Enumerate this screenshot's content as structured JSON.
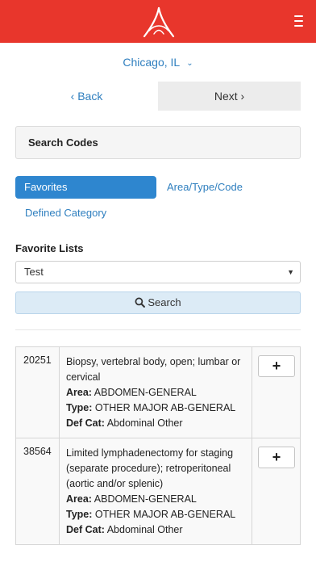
{
  "header": {
    "logo_icon": "caduceus-logo-icon",
    "menu_icon": "hamburger-menu-icon",
    "bar_color": "#e8362c"
  },
  "location": {
    "label": "Chicago, IL",
    "icon": "chevron-down-icon"
  },
  "nav": {
    "back_label": "‹ Back",
    "next_label": "Next ›"
  },
  "panel": {
    "title": "Search Codes"
  },
  "filters": {
    "active": "Favorites",
    "tabs": [
      "Favorites",
      "Area/Type/Code",
      "Defined Category"
    ]
  },
  "favorites": {
    "label": "Favorite Lists",
    "selected": "Test"
  },
  "search": {
    "label": "Search",
    "icon": "search-icon"
  },
  "results": [
    {
      "code": "20251",
      "description": "Biopsy, vertebral body, open; lumbar or cervical",
      "area_label": "Area:",
      "area": "ABDOMEN-GENERAL",
      "type_label": "Type:",
      "type": "OTHER MAJOR AB-GENERAL",
      "defcat_label": "Def Cat:",
      "defcat": "Abdominal Other",
      "add_label": "+"
    },
    {
      "code": "38564",
      "description": "Limited lymphadenectomy for staging (separate procedure); retroperitoneal (aortic and/or splenic)",
      "area_label": "Area:",
      "area": "ABDOMEN-GENERAL",
      "type_label": "Type:",
      "type": "OTHER MAJOR AB-GENERAL",
      "defcat_label": "Def Cat:",
      "defcat": "Abdominal Other",
      "add_label": "+"
    }
  ]
}
